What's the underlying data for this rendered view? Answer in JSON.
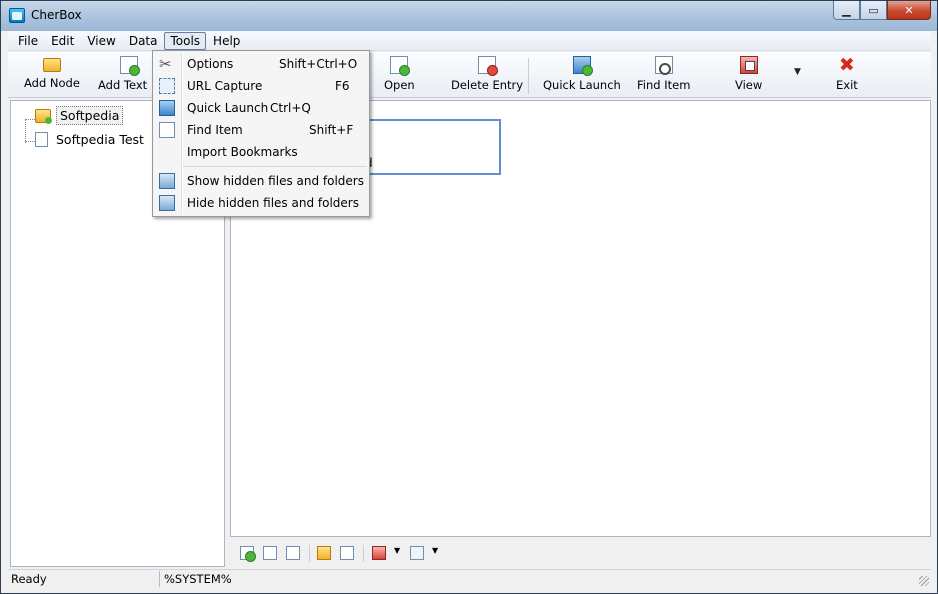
{
  "window": {
    "title": "CherBox",
    "controls": {
      "minimize": "▁",
      "maximize": "▭",
      "close": "✕"
    }
  },
  "menubar": {
    "items": [
      "File",
      "Edit",
      "View",
      "Data",
      "Tools",
      "Help"
    ],
    "open_item": "Tools"
  },
  "toolbar": {
    "buttons": [
      {
        "label": "Add Node",
        "icon": "folder-add-icon"
      },
      {
        "label": "Add Text N",
        "icon": "document-add-icon"
      },
      {
        "label": "Open",
        "icon": "open-icon"
      },
      {
        "label": "Delete Entry",
        "icon": "delete-document-icon"
      },
      {
        "label": "Quick Launch",
        "icon": "quick-launch-icon"
      },
      {
        "label": "Find Item",
        "icon": "find-item-icon"
      },
      {
        "label": "View",
        "icon": "view-icon"
      },
      {
        "label": "Exit",
        "icon": "exit-icon"
      }
    ],
    "dropdown_arrow": "▼"
  },
  "tree": {
    "nodes": [
      {
        "label": "Softpedia",
        "type": "folder",
        "selected": true
      },
      {
        "label": "Softpedia Test",
        "type": "document",
        "selected": false
      }
    ]
  },
  "content": {
    "partial_text": "d"
  },
  "tools_menu": {
    "items": [
      {
        "label": "Options",
        "shortcut": "Shift+Ctrl+O",
        "icon": "tools-icon"
      },
      {
        "label": "URL Capture",
        "shortcut": "F6",
        "icon": "capture-icon"
      },
      {
        "label": "Quick Launch",
        "shortcut": "Ctrl+Q",
        "icon": "quick-launch-icon"
      },
      {
        "label": "Find Item",
        "shortcut": "Shift+F",
        "icon": "find-item-icon"
      },
      {
        "label": "Import Bookmarks",
        "shortcut": "",
        "icon": ""
      },
      {
        "label": "Show hidden files and folders",
        "shortcut": "",
        "icon": "show-hidden-icon"
      },
      {
        "label": "Hide hidden files and folders",
        "shortcut": "",
        "icon": "hide-hidden-icon"
      }
    ]
  },
  "statusbar": {
    "status": "Ready",
    "path": "%SYSTEM%"
  },
  "colors": {
    "title_gradient_top": "#c9d8ea",
    "close_button": "#c8492f",
    "selection_border": "#5f8fcf"
  }
}
